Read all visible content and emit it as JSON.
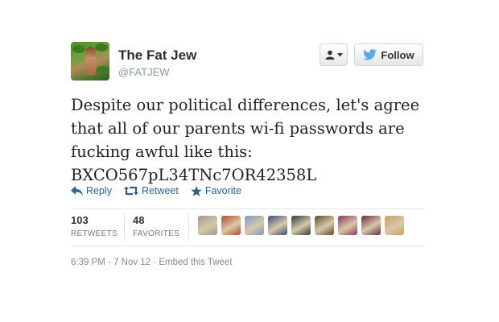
{
  "user": {
    "name": "The Fat Jew",
    "handle": "@FATJEW"
  },
  "buttons": {
    "follow": "Follow"
  },
  "tweet": {
    "lines": [
      "Despite our political differences, let's agree",
      "that all of our parents wi-fi passwords are",
      "fucking awful like this:",
      "BXCO567pL34TNc7OR42358L"
    ]
  },
  "actions": {
    "reply": "Reply",
    "retweet": "Retweet",
    "favorite": "Favorite"
  },
  "stats": {
    "retweets": {
      "count": "103",
      "label": "RETWEETS"
    },
    "favorites": {
      "count": "48",
      "label": "FAVORITES"
    }
  },
  "favoriters": [
    {
      "icon": "user-avatar-1",
      "color": "#9a9a8c"
    },
    {
      "icon": "user-avatar-2",
      "color": "#b84a2a"
    },
    {
      "icon": "user-avatar-3",
      "color": "#7c9ac8"
    },
    {
      "icon": "user-avatar-4",
      "color": "#3a4a7a"
    },
    {
      "icon": "user-avatar-5",
      "color": "#2b3a3a"
    },
    {
      "icon": "user-avatar-6",
      "color": "#5a4a2a"
    },
    {
      "icon": "user-avatar-7",
      "color": "#8a3a5a"
    },
    {
      "icon": "user-avatar-8",
      "color": "#6a2a3a"
    },
    {
      "icon": "user-avatar-9",
      "color": "#c8a060"
    }
  ],
  "footer": {
    "time": "6:39 PM - 7 Nov 12",
    "separator": " · ",
    "embed": "Embed this Tweet"
  },
  "colors": {
    "link": "#2a6496",
    "twitter_bird": "#55acee"
  }
}
